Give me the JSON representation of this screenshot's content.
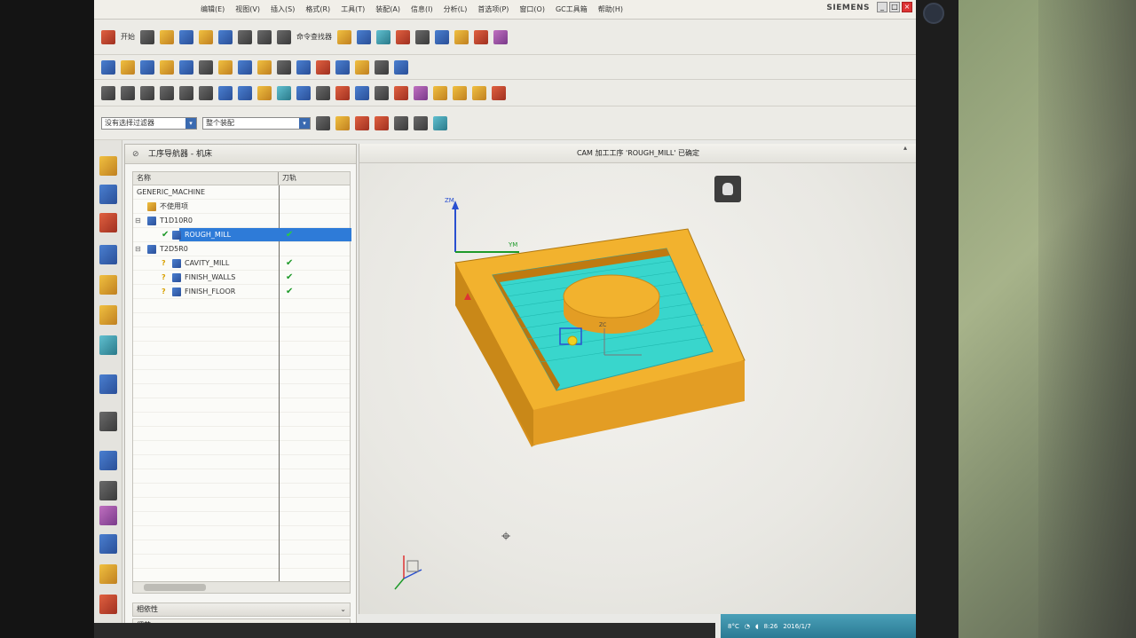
{
  "window": {
    "brand": "SIEMENS",
    "controls": [
      "_",
      "□",
      "×"
    ]
  },
  "menu": {
    "items": [
      "编辑(E)",
      "视图(V)",
      "插入(S)",
      "格式(R)",
      "工具(T)",
      "装配(A)",
      "信息(I)",
      "分析(L)",
      "首选项(P)",
      "窗口(O)",
      "GC工具箱",
      "帮助(H)"
    ]
  },
  "toolbar": {
    "start_label": "开始",
    "find_command_label": "命令查找器",
    "filter_select": "没有选择过滤器",
    "assembly_select": "整个装配"
  },
  "navigator": {
    "title": "工序导航器 - 机床",
    "col_name": "名称",
    "col_tool_change": "刀轨",
    "rows": [
      {
        "label": "GENERIC_MACHINE",
        "check": ""
      },
      {
        "label": "不使用项",
        "check": ""
      },
      {
        "label": "T1D10R0",
        "check": ""
      },
      {
        "label": "ROUGH_MILL",
        "check": "✔"
      },
      {
        "label": "T2D5R0",
        "check": ""
      },
      {
        "label": "CAVITY_MILL",
        "check": "✔"
      },
      {
        "label": "FINISH_WALLS",
        "check": "✔"
      },
      {
        "label": "FINISH_FLOOR",
        "check": "✔"
      }
    ],
    "panel_dependencies": "相依性",
    "panel_details": "细节"
  },
  "graphics": {
    "title": "CAM 加工工序 'ROUGH_MILL' 已确定",
    "axes": {
      "zm": "ZM",
      "ym": "YM",
      "zc": "ZC"
    }
  },
  "status": {
    "temperature": "8°C",
    "time": "8:26",
    "date": "2016/1/7"
  },
  "colors": {
    "part": "#f2b22e",
    "part_dark": "#d6921a",
    "toolpath": "#39d6cc",
    "selection": "#2e7bd8",
    "check": "#1e9a2a"
  }
}
